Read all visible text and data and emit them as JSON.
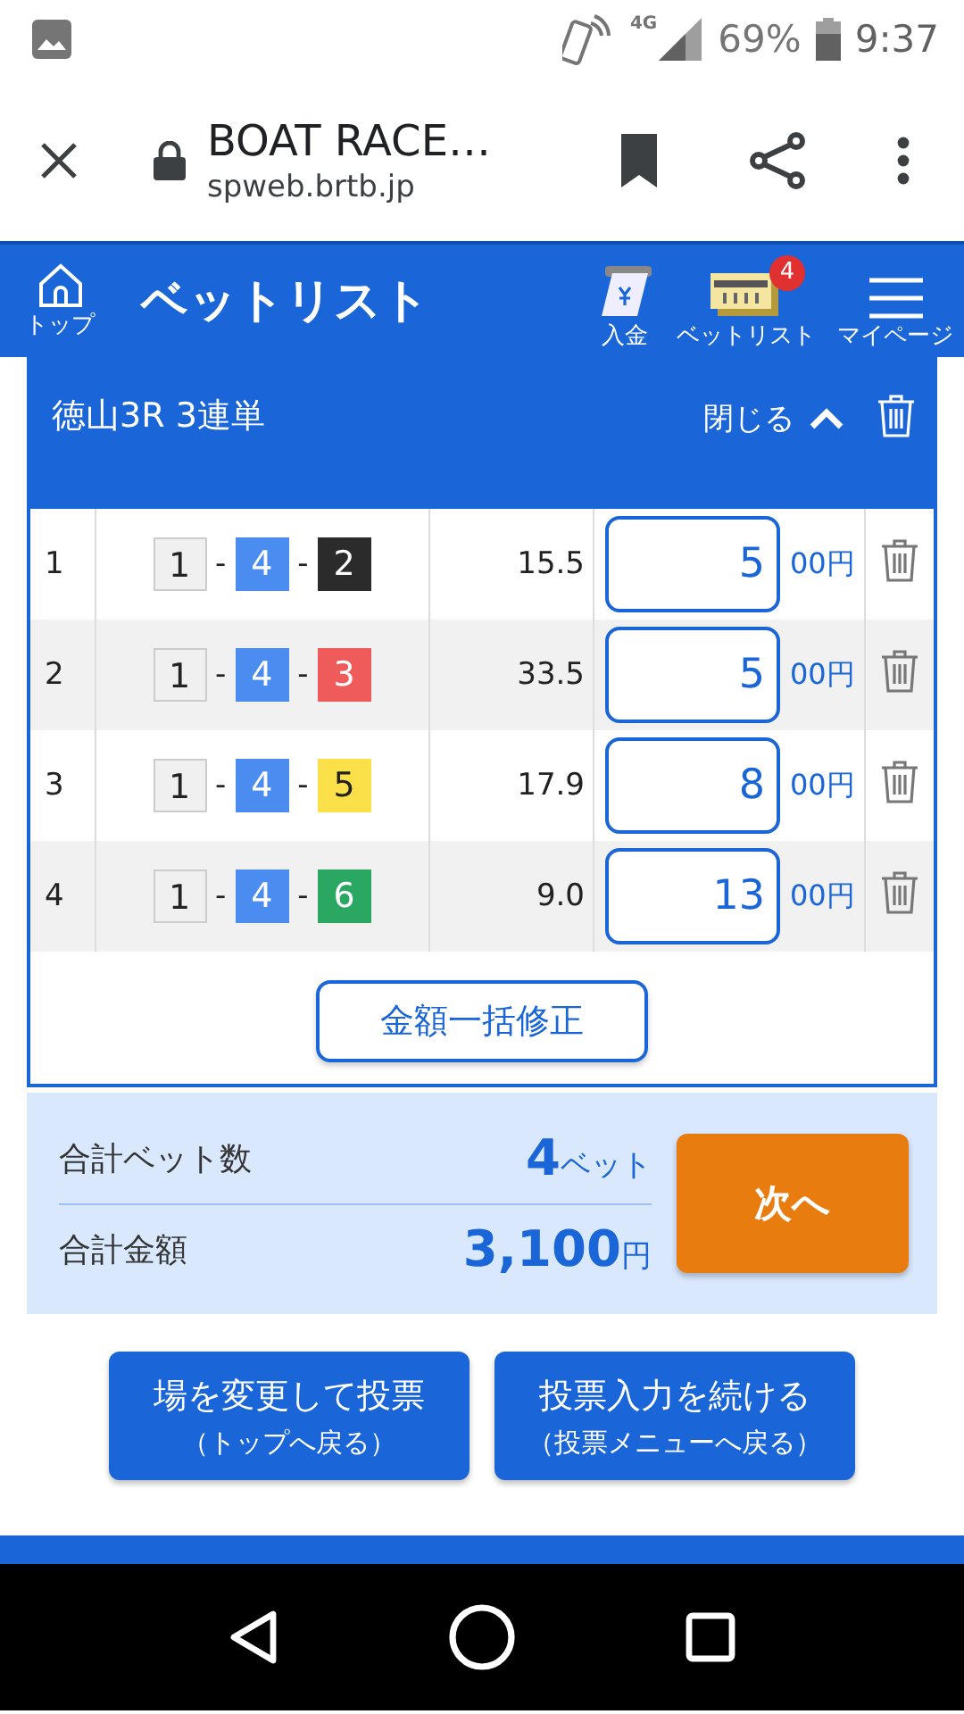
{
  "status_bar": {
    "signal_label": "4G",
    "battery": "69%",
    "time": "9:37"
  },
  "browser_bar": {
    "title": "BOAT RACE…",
    "url": "spweb.brtb.jp"
  },
  "header": {
    "home_label": "トップ",
    "title": "ベットリスト",
    "nav": [
      {
        "kind": "deposit",
        "label": "入金"
      },
      {
        "kind": "betlist",
        "label": "ベットリスト",
        "badge": "4"
      },
      {
        "kind": "menu",
        "label": "マイページ"
      }
    ]
  },
  "bet_card": {
    "title": "徳山3R 3連単",
    "toggle_label": "閉じる",
    "expanded": true,
    "rows": [
      {
        "number": "1",
        "boats": [
          {
            "number": "1",
            "color": "#f0f0f0"
          },
          {
            "number": "4",
            "color": "#4a8cf0"
          },
          {
            "number": "2",
            "color": "#2b2b2b"
          }
        ],
        "odds": "15.5",
        "amount": "5",
        "unit": "00円"
      },
      {
        "number": "2",
        "boats": [
          {
            "number": "1",
            "color": "#f0f0f0"
          },
          {
            "number": "4",
            "color": "#4a8cf0"
          },
          {
            "number": "3",
            "color": "#ef5b5b"
          }
        ],
        "odds": "33.5",
        "amount": "5",
        "unit": "00円"
      },
      {
        "number": "3",
        "boats": [
          {
            "number": "1",
            "color": "#f0f0f0"
          },
          {
            "number": "4",
            "color": "#4a8cf0"
          },
          {
            "number": "5",
            "color": "#fbe04a"
          }
        ],
        "odds": "17.9",
        "amount": "8",
        "unit": "00円"
      },
      {
        "number": "4",
        "boats": [
          {
            "number": "1",
            "color": "#f0f0f0"
          },
          {
            "number": "4",
            "color": "#4a8cf0"
          },
          {
            "number": "6",
            "color": "#2aa862"
          }
        ],
        "odds": "9.0",
        "amount": "13",
        "unit": "00円"
      }
    ],
    "separator": "-",
    "bulk_edit_button": "金額一括修正"
  },
  "summary": {
    "count_label": "合計ベット数",
    "count": "4",
    "count_unit": "ベット",
    "total_label": "合計金額",
    "total": "3,100",
    "total_unit": "円",
    "next_button": "次へ"
  },
  "actions": [
    {
      "label": "場を変更して投票",
      "sub": "（トップへ戻る）"
    },
    {
      "label": "投票入力を続ける",
      "sub": "（投票メニューへ戻る）"
    }
  ]
}
